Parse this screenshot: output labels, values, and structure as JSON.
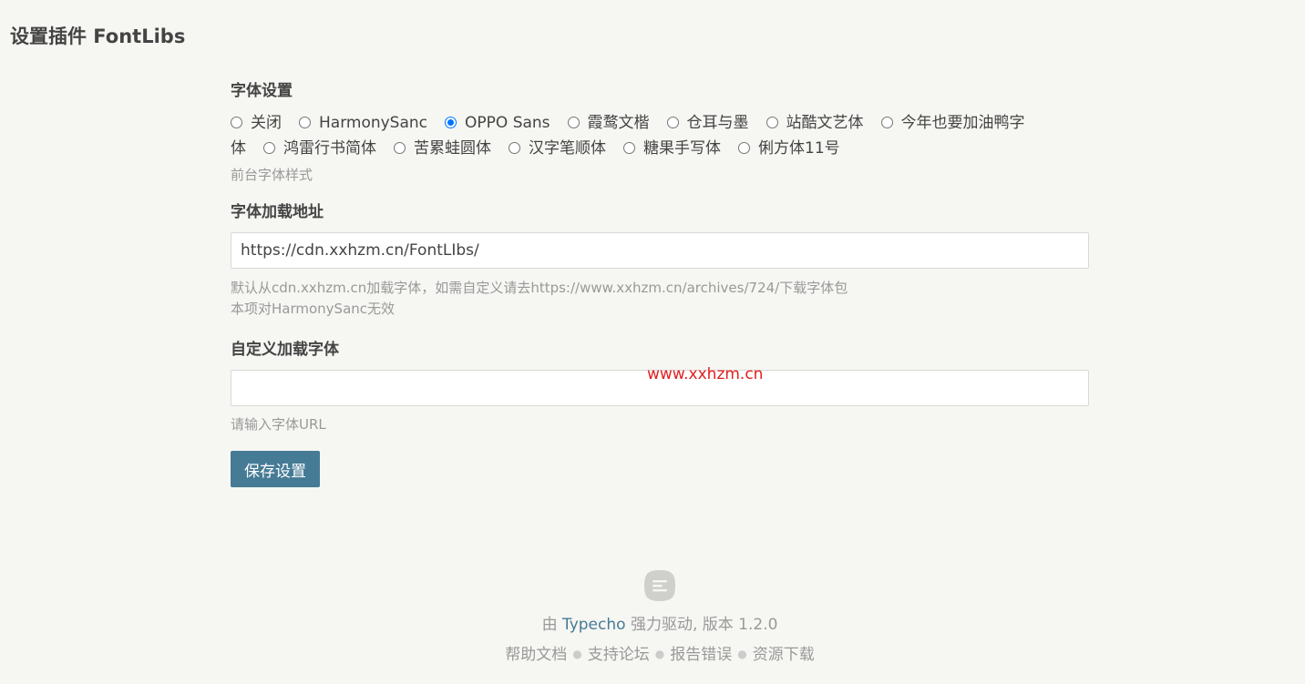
{
  "page": {
    "title": "设置插件 FontLibs"
  },
  "font_settings": {
    "label": "字体设置",
    "options": [
      {
        "label": "关闭",
        "checked": false
      },
      {
        "label": "HarmonySanc",
        "checked": false
      },
      {
        "label": "OPPO Sans",
        "checked": true
      },
      {
        "label": "霞鹜文楷",
        "checked": false
      },
      {
        "label": "仓耳与墨",
        "checked": false
      },
      {
        "label": "站酷文艺体",
        "checked": false
      },
      {
        "label": "今年也要加油鸭字体",
        "checked": false
      },
      {
        "label": "鸿雷行书简体",
        "checked": false
      },
      {
        "label": "苦累蛙圆体",
        "checked": false
      },
      {
        "label": "汉字笔顺体",
        "checked": false
      },
      {
        "label": "糖果手写体",
        "checked": false
      },
      {
        "label": "俐方体11号",
        "checked": false
      }
    ],
    "option_6_line1": "今年也要加油鸭字",
    "option_6_line2": "体",
    "description": "前台字体样式"
  },
  "font_load_url": {
    "label": "字体加载地址",
    "value": "https://cdn.xxhzm.cn/FontLIbs/",
    "description_line1": "默认从cdn.xxhzm.cn加载字体，如需自定义请去https://www.xxhzm.cn/archives/724/下载字体包",
    "description_line2": "本项对HarmonySanc无效"
  },
  "custom_font": {
    "label": "自定义加载字体",
    "value": "",
    "placeholder": "",
    "description": "请输入字体URL"
  },
  "save_button": {
    "label": "保存设置"
  },
  "watermark": {
    "text": "www.xxhzm.cn",
    "color": "#e02020"
  },
  "footer": {
    "logo_icon": "typecho-logo-icon",
    "powered_prefix": "由",
    "powered_link": "Typecho",
    "powered_suffix": "强力驱动, 版本 1.2.0",
    "links": [
      "帮助文档",
      "支持论坛",
      "报告错误",
      "资源下载"
    ]
  },
  "colors": {
    "accent": "#467b96",
    "radio_checked": "#0075ff",
    "background": "#f6f6f3"
  }
}
